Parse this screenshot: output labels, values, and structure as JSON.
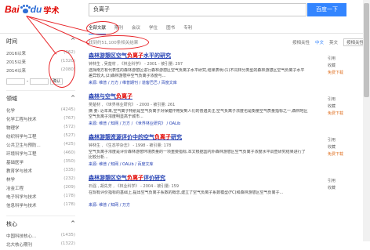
{
  "logo": {
    "text_bai": "Bai",
    "text_du": "du",
    "text_xueshu": "学术"
  },
  "search": {
    "query": "负离子",
    "button": "百度一下"
  },
  "tabs": [
    "全部文献",
    "期刊",
    "会议",
    "学位",
    "图书",
    "专利"
  ],
  "sidebar": {
    "time_heading": "时间",
    "years": [
      {
        "label": "2016以来",
        "count": "(362)"
      },
      {
        "label": "2015以来",
        "count": "(1320)"
      },
      {
        "label": "2014以来",
        "count": "(2080)"
      }
    ],
    "confirm": "确认",
    "field_heading": "领域",
    "fields": [
      {
        "label": "化学",
        "count": "(4245)"
      },
      {
        "label": "化学工程与技术",
        "count": "(767)"
      },
      {
        "label": "物理学",
        "count": "(572)"
      },
      {
        "label": "纺织科学与工程",
        "count": "(527)"
      },
      {
        "label": "公共卫生与预防...",
        "count": "(425)"
      },
      {
        "label": "环境科学与工程",
        "count": "(460)"
      },
      {
        "label": "基础医学",
        "count": "(350)"
      },
      {
        "label": "教育学与技术",
        "count": "(335)"
      },
      {
        "label": "林学",
        "count": "(232)"
      },
      {
        "label": "冶金工程",
        "count": "(209)"
      },
      {
        "label": "电子科学与技术",
        "count": "(178)"
      },
      {
        "label": "信息科学与技术",
        "count": "(178)"
      }
    ],
    "core_heading": "核心",
    "cores": [
      {
        "label": "中国科技核心...",
        "count": "(1435)"
      },
      {
        "label": "北大核心期刊",
        "count": "(1322)"
      }
    ]
  },
  "statbar": {
    "result_text": "找到约51,100条相关结果",
    "sort_label": "按相关性",
    "lang_label": "中文",
    "en_label": "英文",
    "sort_select": "按相关性"
  },
  "results": [
    {
      "title_pre": "森林游憩区空气",
      "title_kw": "负离子",
      "title_post": "水平的研究",
      "meta": "钟林生 , 吴楚材 , 《林业科学》 - 2001 - 被引量: 297",
      "abstract": "选择南方有代表性的森林游憩区进行森林游憩区空气负离子水平研究,结果表明:(1)不同林分类型的森林游憩区空气负离子水平差异较大,(2)森林游憩中空气负离子浓度与...",
      "source": "来源: 维普 / 万方 / 维普期刊 / 道客巴巴 / 百度文库",
      "actions": [
        "引用",
        "收藏",
        "免费下载"
      ]
    },
    {
      "title_pre": "森林与空气",
      "title_kw": "负离子",
      "title_post": "",
      "meta": "吴楚材 , 《世界林业研究》 - 2000 - 被引量: 261",
      "abstract": "摘 要: 近年来,空气离子特别是空气负离子对保健作用受到人们的普遍关注,空气负离子浓度也是衡量空气质量指标之一,森林地区空气负离子浓度明显高于城市...",
      "source": "来源: 维普 / 知网 / 万方 / 《世界林业研究》 / OALib",
      "actions": [
        "引用",
        "收藏",
        "免费下载"
      ]
    },
    {
      "title_pre": "森林游憩资源评价中的空气",
      "title_kw": "负离子",
      "title_post": "研究",
      "meta": "钟林生 , 《生态学杂志》 - 1998 - 被引量: 178",
      "abstract": "空气负离子浓度是评价森林游憩环境质量的一项重要指标,本文根据国内外森林游憩区空气负离子浓度水平调查研究结果进行了比较分析...",
      "source": "来源: 维普 / 知网 / OALib / 百度文库",
      "actions": [
        "引用",
        "收藏",
        "免费下载"
      ]
    },
    {
      "title_pre": "森林游憩区空气",
      "title_kw": "负离子",
      "title_post": "评价研究",
      "meta": "石强 , 胡先芳 , 《林业科学》 - 2004 - 被引量: 159",
      "abstract": "在现有评价指标的基础上,提出空气负离子系数的概念,建立了空气负离子系数模型(FC)和森林游憩区空气负离子...",
      "source": "来源: 维普 / 知网 / 万方",
      "actions": [
        "引用",
        "收藏"
      ]
    }
  ]
}
